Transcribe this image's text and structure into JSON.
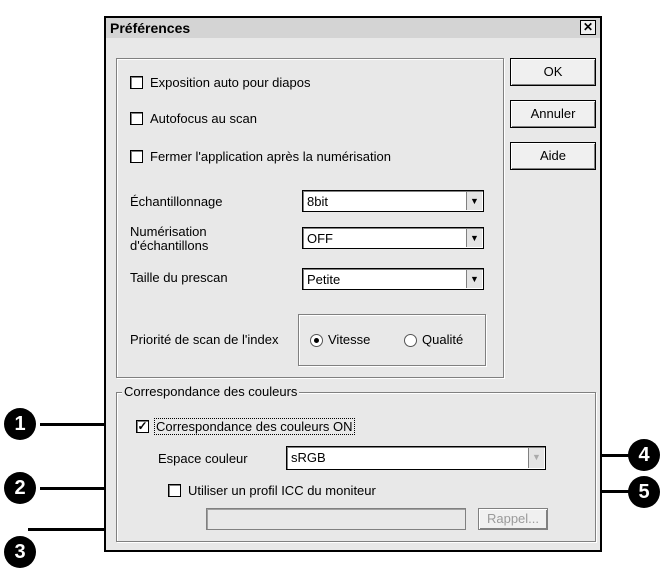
{
  "dialog": {
    "title": "Préférences",
    "close_glyph": "✕"
  },
  "buttons": {
    "ok": "OK",
    "cancel": "Annuler",
    "help": "Aide",
    "recall": "Rappel..."
  },
  "options": {
    "auto_exposure": {
      "label": "Exposition auto pour diapos",
      "checked": false
    },
    "autofocus": {
      "label": "Autofocus au scan",
      "checked": false
    },
    "close_app": {
      "label": "Fermer l'application après la numérisation",
      "checked": false
    }
  },
  "sampling": {
    "label": "Échantillonnage",
    "value": "8bit"
  },
  "multi_sampling": {
    "label_line1": "Numérisation",
    "label_line2": "d'échantillons",
    "value": "OFF"
  },
  "prescan_size": {
    "label": "Taille du prescan",
    "value": "Petite"
  },
  "index_priority": {
    "label": "Priorité de scan de l'index",
    "options": [
      "Vitesse",
      "Qualité"
    ],
    "selected": "Vitesse"
  },
  "color_matching": {
    "group_label": "Correspondance des couleurs",
    "enable_label": "Correspondance des couleurs ON",
    "enabled": true,
    "check_glyph": "✓",
    "color_space_label": "Espace couleur",
    "color_space_value": "sRGB",
    "icc_label": "Utiliser un profil ICC du moniteur",
    "icc_enabled": false,
    "icc_path": ""
  },
  "callouts": [
    "1",
    "2",
    "3",
    "4",
    "5"
  ],
  "dropdown_glyph": "▼"
}
